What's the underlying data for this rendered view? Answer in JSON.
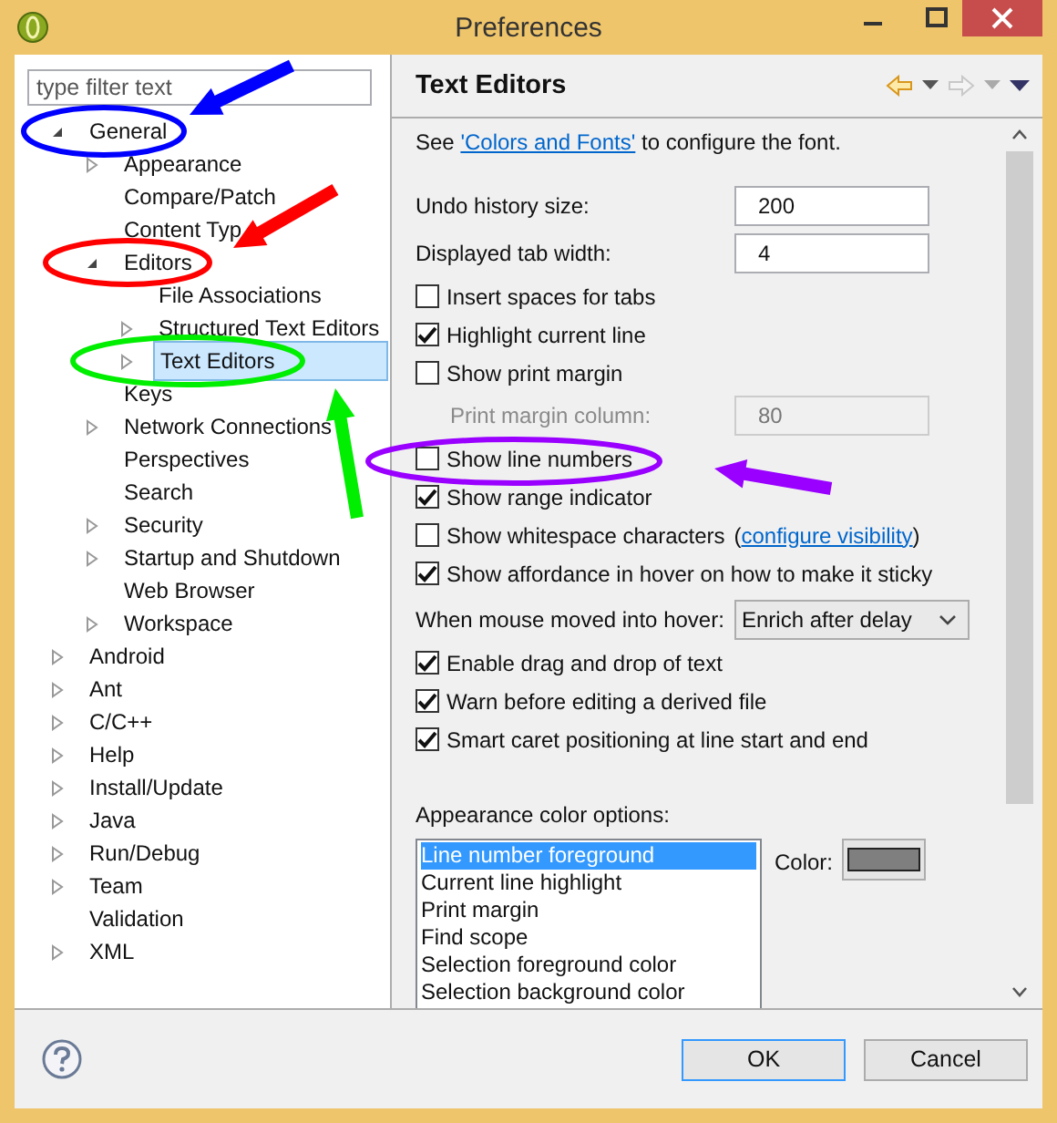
{
  "window": {
    "title": "Preferences"
  },
  "filter": {
    "placeholder": "type filter text"
  },
  "tree": [
    {
      "label": "General",
      "expanded": true,
      "selected": false,
      "children": [
        {
          "label": "Appearance",
          "expanded": false,
          "selected": false
        },
        {
          "label": "Compare/Patch",
          "selected": false
        },
        {
          "label": "Content Typ",
          "selected": false
        },
        {
          "label": "Editors",
          "expanded": true,
          "selected": false,
          "children": [
            {
              "label": "File Associations",
              "selected": false
            },
            {
              "label": "Structured Text Editors",
              "expanded": false,
              "selected": false
            },
            {
              "label": "Text Editors",
              "expanded": false,
              "selected": true
            }
          ]
        },
        {
          "label": "Keys",
          "selected": false
        },
        {
          "label": "Network Connections",
          "expanded": false,
          "selected": false
        },
        {
          "label": "Perspectives",
          "selected": false
        },
        {
          "label": "Search",
          "selected": false
        },
        {
          "label": "Security",
          "expanded": false,
          "selected": false
        },
        {
          "label": "Startup and Shutdown",
          "expanded": false,
          "selected": false
        },
        {
          "label": "Web Browser",
          "selected": false
        },
        {
          "label": "Workspace",
          "expanded": false,
          "selected": false
        }
      ]
    },
    {
      "label": "Android",
      "expanded": false,
      "selected": false
    },
    {
      "label": "Ant",
      "expanded": false,
      "selected": false
    },
    {
      "label": "C/C++",
      "expanded": false,
      "selected": false
    },
    {
      "label": "Help",
      "expanded": false,
      "selected": false
    },
    {
      "label": "Install/Update",
      "expanded": false,
      "selected": false
    },
    {
      "label": "Java",
      "expanded": false,
      "selected": false
    },
    {
      "label": "Run/Debug",
      "expanded": false,
      "selected": false
    },
    {
      "label": "Team",
      "expanded": false,
      "selected": false
    },
    {
      "label": "Validation",
      "selected": false
    },
    {
      "label": "XML",
      "expanded": false,
      "selected": false
    }
  ],
  "page": {
    "title": "Text Editors",
    "intro": {
      "before": "See ",
      "link": "'Colors and Fonts'",
      "after": " to configure the font."
    },
    "settings": [
      {
        "kind": "field",
        "label": "Undo history size:",
        "value": "200",
        "disabled": false,
        "indented": false
      },
      {
        "kind": "field",
        "label": "Displayed tab width:",
        "value": "4",
        "disabled": false,
        "indented": false
      },
      {
        "kind": "checkbox",
        "label": "Insert spaces for tabs",
        "checked": false
      },
      {
        "kind": "checkbox",
        "label": "Highlight current line",
        "checked": true
      },
      {
        "kind": "checkbox",
        "label": "Show print margin",
        "checked": false
      },
      {
        "kind": "field",
        "label": "Print margin column:",
        "value": "80",
        "disabled": true,
        "indented": true
      },
      {
        "kind": "checkbox",
        "label": "Show line numbers",
        "checked": false
      },
      {
        "kind": "checkbox",
        "label": "Show range indicator",
        "checked": true
      },
      {
        "kind": "checkbox",
        "label": "Show whitespace characters",
        "checked": false,
        "link_before": "(",
        "link": "configure visibility",
        "link_after": ")"
      },
      {
        "kind": "checkbox",
        "label": "Show affordance in hover on how to make it sticky",
        "checked": true
      },
      {
        "kind": "select",
        "label": "When mouse moved into hover:",
        "value": "Enrich after delay"
      },
      {
        "kind": "checkbox",
        "label": "Enable drag and drop of text",
        "checked": true
      },
      {
        "kind": "checkbox",
        "label": "Warn before editing a derived file",
        "checked": true
      },
      {
        "kind": "checkbox",
        "label": "Smart caret positioning at line start and end",
        "checked": true
      }
    ],
    "color_options": {
      "label": "Appearance color options:",
      "color_label": "Color:",
      "items": [
        {
          "label": "Line number foreground",
          "selected": true
        },
        {
          "label": "Current line highlight",
          "selected": false
        },
        {
          "label": "Print margin",
          "selected": false
        },
        {
          "label": "Find scope",
          "selected": false
        },
        {
          "label": "Selection foreground color",
          "selected": false
        },
        {
          "label": "Selection background color",
          "selected": false
        }
      ]
    }
  },
  "buttons": [
    {
      "label": "OK",
      "default": true
    },
    {
      "label": "Cancel",
      "default": false
    }
  ],
  "annotations": [
    {
      "kind": "ellipse",
      "color": "#0000ff"
    },
    {
      "kind": "arrow",
      "color": "#0000ff"
    },
    {
      "kind": "ellipse",
      "color": "#ff0000"
    },
    {
      "kind": "arrow",
      "color": "#ff0000"
    },
    {
      "kind": "ellipse",
      "color": "#00ee00"
    },
    {
      "kind": "arrow",
      "color": "#00ee00"
    },
    {
      "kind": "ellipse",
      "color": "#9900ff"
    },
    {
      "kind": "arrow",
      "color": "#9900ff"
    }
  ]
}
